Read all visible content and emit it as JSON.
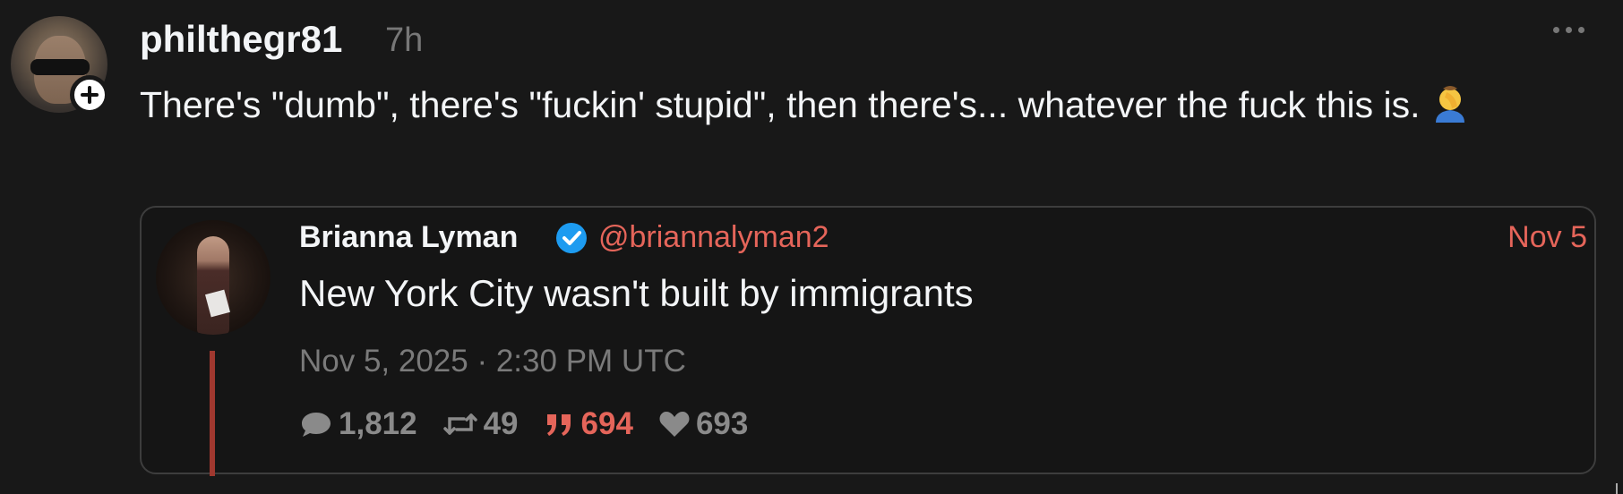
{
  "post": {
    "username": "philthegr81",
    "time": "7h",
    "text": "There's \"dumb\", there's \"fuckin' stupid\", then there's... whatever the fuck this is.",
    "emoji": "🤦‍♂️"
  },
  "quote": {
    "name": "Brianna Lyman",
    "handle": "@briannalyman2",
    "date": "Nov 5",
    "text": "New York City wasn't built by immigrants",
    "timestamp": "Nov 5, 2025 · 2:30 PM UTC",
    "stats": {
      "replies": "1,812",
      "reposts": "49",
      "quotes": "694",
      "likes": "693"
    }
  },
  "colors": {
    "accent": "#e5655a",
    "background": "#181818",
    "verified": "#1d9bf0"
  },
  "icons": [
    "plus-icon",
    "more-icon",
    "verified-icon",
    "reply-icon",
    "repost-icon",
    "quote-icon",
    "like-icon"
  ]
}
